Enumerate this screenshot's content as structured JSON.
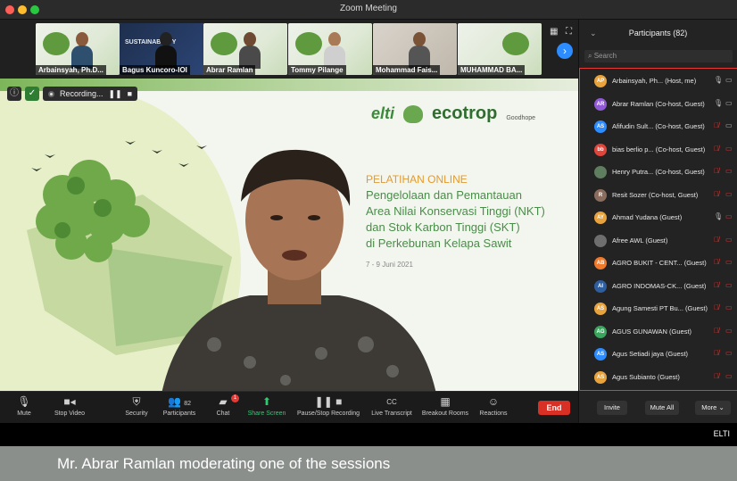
{
  "window": {
    "title": "Zoom Meeting"
  },
  "traffic_lights": [
    "#ff5f57",
    "#febc2e",
    "#28c840"
  ],
  "thumbnails": [
    {
      "name": "Arbainsyah, Ph.D..."
    },
    {
      "name": "Bagus Kuncoro-IOI",
      "overlay": "SUSTAINABILITY"
    },
    {
      "name": "Abrar Ramlan"
    },
    {
      "name": "Tommy Pilange"
    },
    {
      "name": "Mohammad Fais..."
    },
    {
      "name": "MUHAMMAD BA..."
    }
  ],
  "recording": {
    "label": "Recording..."
  },
  "slide": {
    "logos": {
      "elti": "elti",
      "ecotrop": "ecotrop",
      "goodhope": "Goodhope"
    },
    "kicker": "PELATIHAN ONLINE",
    "lines": [
      "Pengelolaan dan Pemantauan",
      "Area Nilai Konservasi Tinggi (NKT)",
      "dan Stok Karbon Tinggi (SKT)",
      "di Perkebunan Kelapa Sawit"
    ],
    "date": "7 - 9 Juni 2021"
  },
  "toolbar": {
    "mute": "Mute",
    "stop_video": "Stop Video",
    "security": "Security",
    "participants": "Participants",
    "participants_count": "82",
    "chat": "Chat",
    "chat_badge": "1",
    "share_screen": "Share Screen",
    "pause_recording": "Pause/Stop Recording",
    "live_transcript": "Live Transcript",
    "breakout_rooms": "Breakout Rooms",
    "reactions": "Reactions",
    "end": "End",
    "cc_icon_text": "CC"
  },
  "participants_panel": {
    "title": "Participants (82)",
    "search_placeholder": "Search",
    "participants": [
      {
        "initials": "AP",
        "name": "Arbainsyah, Ph... (Host, me)",
        "color": "#e8a33d",
        "mic": "on",
        "cam": "on"
      },
      {
        "initials": "AR",
        "name": "Abrar Ramlan (Co-host, Guest)",
        "color": "#8e5ad6",
        "mic": "on",
        "cam": "on"
      },
      {
        "initials": "AS",
        "name": "Afifudin Sult... (Co-host, Guest)",
        "color": "#2d8cff",
        "mic": "off",
        "cam": "on"
      },
      {
        "initials": "bb",
        "name": "bias berlio p... (Co-host, Guest)",
        "color": "#e0453b",
        "mic": "off",
        "cam": "off"
      },
      {
        "initials": "",
        "name": "Henry Putra... (Co-host, Guest)",
        "color": "#5f7d5f",
        "mic": "off",
        "cam": "off"
      },
      {
        "initials": "R",
        "name": "Resit Sozer (Co-host, Guest)",
        "color": "#8a6d5e",
        "mic": "off",
        "cam": "off"
      },
      {
        "initials": "AY",
        "name": "Ahmad Yudana (Guest)",
        "color": "#e8a33d",
        "mic": "on",
        "cam": "off"
      },
      {
        "initials": "",
        "name": "Afree AWL (Guest)",
        "color": "#6e6e6e",
        "mic": "off",
        "cam": "off"
      },
      {
        "initials": "AB",
        "name": "AGRO BUKIT - CENT... (Guest)",
        "color": "#f07a2b",
        "mic": "off",
        "cam": "off"
      },
      {
        "initials": "AI",
        "name": "AGRO INDOMAS-CK... (Guest)",
        "color": "#2f5e9e",
        "mic": "off",
        "cam": "off"
      },
      {
        "initials": "AS",
        "name": "Agung Samesti PT Bu... (Guest)",
        "color": "#e8a33d",
        "mic": "off",
        "cam": "off"
      },
      {
        "initials": "AG",
        "name": "AGUS GUNAWAN (Guest)",
        "color": "#3aa55d",
        "mic": "off",
        "cam": "off"
      },
      {
        "initials": "AS",
        "name": "Agus Setiadi jaya (Guest)",
        "color": "#2d8cff",
        "mic": "off",
        "cam": "off"
      },
      {
        "initials": "AS",
        "name": "Agus Subianto (Guest)",
        "color": "#e8a33d",
        "mic": "off",
        "cam": "off"
      }
    ],
    "invite": "Invite",
    "mute_all": "Mute All",
    "more": "More"
  },
  "watermark": "ELTI",
  "caption": "Mr. Abrar Ramlan moderating one of the sessions"
}
